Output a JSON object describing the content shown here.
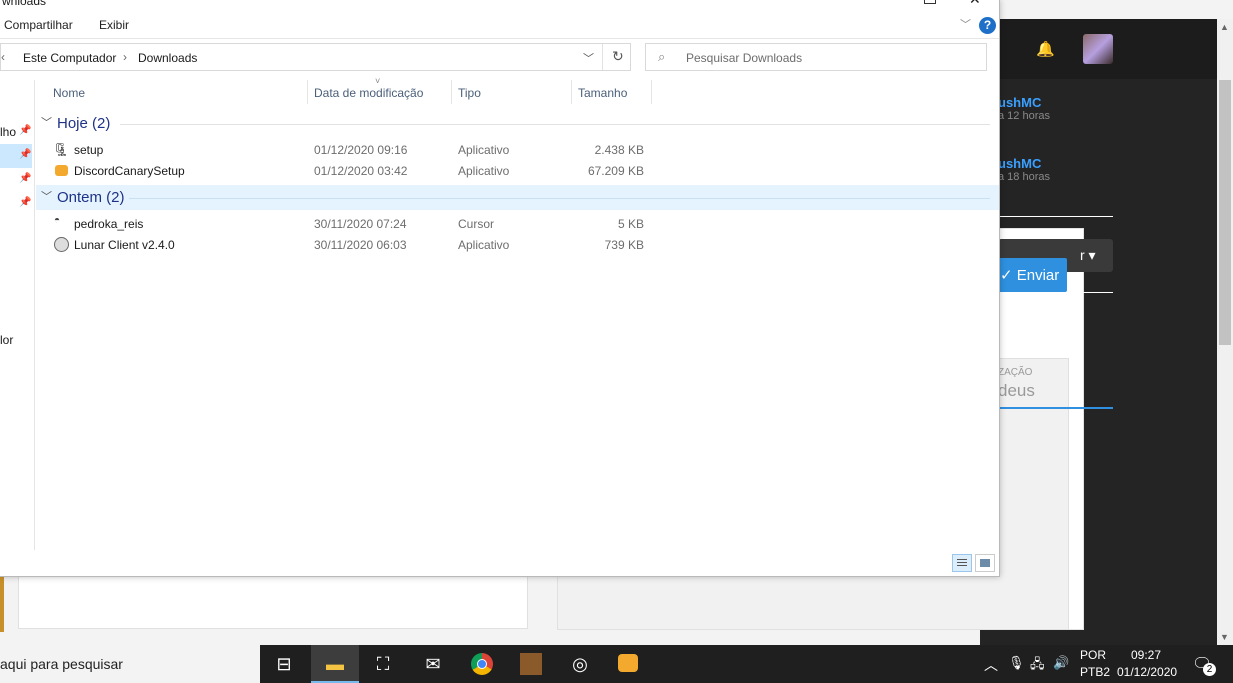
{
  "window": {
    "title_fragment": "wnloads"
  },
  "ribbon": {
    "tabs": [
      "Compartilhar",
      "Exibir"
    ],
    "help": "?"
  },
  "address": {
    "crumbs": [
      "Este Computador",
      "Downloads"
    ],
    "separator": "›"
  },
  "search": {
    "placeholder": "Pesquisar Downloads"
  },
  "nav_pane": {
    "items": [
      "lho",
      "lor"
    ]
  },
  "columns": {
    "name": "Nome",
    "modified": "Data de modificação",
    "type": "Tipo",
    "size": "Tamanho"
  },
  "groups": [
    {
      "title": "Hoje (2)",
      "files": [
        {
          "name": "setup",
          "modified": "01/12/2020 09:16",
          "type": "Aplicativo",
          "size": "2.438 KB",
          "icon": "installer-icon"
        },
        {
          "name": "DiscordCanarySetup",
          "modified": "01/12/2020 03:42",
          "type": "Aplicativo",
          "size": "67.209 KB",
          "icon": "discord-icon"
        }
      ]
    },
    {
      "title": "Ontem (2)",
      "files": [
        {
          "name": "pedroka_reis",
          "modified": "30/11/2020 07:24",
          "type": "Cursor",
          "size": "5 KB",
          "icon": "cursor-file-icon"
        },
        {
          "name": "Lunar Client v2.4.0",
          "modified": "30/11/2020 06:03",
          "type": "Aplicativo",
          "size": "739 KB",
          "icon": "lunar-client-icon"
        }
      ]
    }
  ],
  "background": {
    "notifications": [
      {
        "name": "ushMC",
        "time": "a 12 horas"
      },
      {
        "name": "ushMC",
        "time": "a 18 horas"
      }
    ],
    "dropdown_label": "r ▾",
    "send_button": "✓ Enviar",
    "card_label": "ZAÇÃO",
    "card_text": "deus"
  },
  "taskbar": {
    "search_text": "aqui para pesquisar",
    "language": "POR",
    "layout": "PTB2",
    "time": "09:27",
    "date": "01/12/2020",
    "notifications_count": "2"
  },
  "colors": {
    "accent": "#1e3287",
    "selection": "#cce8ff",
    "group_highlight": "#e5f3ff",
    "taskbar": "#1f1f1f",
    "link_blue": "#3aa0ff",
    "send_button": "#2e90de"
  }
}
